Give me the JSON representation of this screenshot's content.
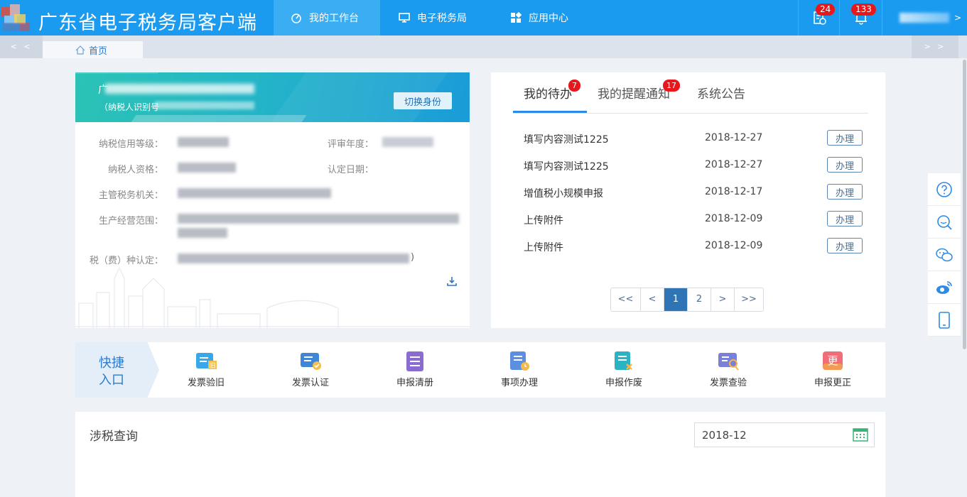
{
  "header": {
    "app_title": "广东省电子税务局客户端",
    "nav": [
      {
        "label": "我的工作台",
        "icon": "dashboard-icon",
        "active": true
      },
      {
        "label": "电子税务局",
        "icon": "monitor-icon",
        "active": false
      },
      {
        "label": "应用中心",
        "icon": "apps-grid-icon",
        "active": false
      }
    ],
    "todo_badge": "24",
    "notify_badge": "133"
  },
  "tabstrip": {
    "left_scroll": "< <",
    "right_scroll": "> >",
    "home_tab": "首页"
  },
  "profile": {
    "name_prefix": "广",
    "taxid_label": "（纳税人识别号",
    "switch_button": "切换身份",
    "fields": [
      {
        "label": "纳税信用等级："
      },
      {
        "label": "纳税人资格："
      },
      {
        "label": "主管税务机关："
      },
      {
        "label": "生产经营范围："
      },
      {
        "label": "税（费）种认定："
      }
    ],
    "fields_right": [
      {
        "label": "评审年度："
      },
      {
        "label": "认定日期："
      }
    ],
    "tax_type_tail": ")"
  },
  "tasks": {
    "tabs": [
      {
        "label": "我的待办",
        "badge": "7",
        "active": true
      },
      {
        "label": "我的提醒通知",
        "badge": "17",
        "active": false
      },
      {
        "label": "系统公告",
        "badge": "",
        "active": false
      }
    ],
    "rows": [
      {
        "title": "填写内容测试1225",
        "date": "2018-12-27",
        "action": "办理"
      },
      {
        "title": "填写内容测试1225",
        "date": "2018-12-27",
        "action": "办理"
      },
      {
        "title": "增值税小规模申报",
        "date": "2018-12-17",
        "action": "办理"
      },
      {
        "title": "上传附件",
        "date": "2018-12-09",
        "action": "办理"
      },
      {
        "title": "上传附件",
        "date": "2018-12-09",
        "action": "办理"
      }
    ],
    "pager": {
      "first": "<<",
      "prev": "<",
      "pages": [
        "1",
        "2"
      ],
      "current": "1",
      "next": ">",
      "last": ">>"
    }
  },
  "side_tools": [
    "help-icon",
    "search-chat-icon",
    "wechat-icon",
    "weibo-icon",
    "mobile-icon"
  ],
  "quick_entry": {
    "title": "快捷入口",
    "items": [
      {
        "label": "发票验旧",
        "icon": "invoice-check-old-icon",
        "color": "#3aa7e8"
      },
      {
        "label": "发票认证",
        "icon": "invoice-certify-icon",
        "color": "#3f86d8"
      },
      {
        "label": "申报清册",
        "icon": "declaration-list-icon",
        "color": "#8a6cd1"
      },
      {
        "label": "事项办理",
        "icon": "task-handle-icon",
        "color": "#5c8fe0"
      },
      {
        "label": "申报作废",
        "icon": "declaration-void-icon",
        "color": "#2bb3c4"
      },
      {
        "label": "发票查验",
        "icon": "invoice-inspect-icon",
        "color": "#7a7fd8"
      },
      {
        "label": "申报更正",
        "icon": "declaration-correct-icon",
        "color": "#f06e7a",
        "glyph": "更"
      }
    ]
  },
  "tax_query": {
    "title": "涉税查询",
    "date_value": "2018-12"
  },
  "colors": {
    "header_blue": "#1a9bf0",
    "accent_blue": "#2d8ae6",
    "badge_red": "#e8171b"
  }
}
